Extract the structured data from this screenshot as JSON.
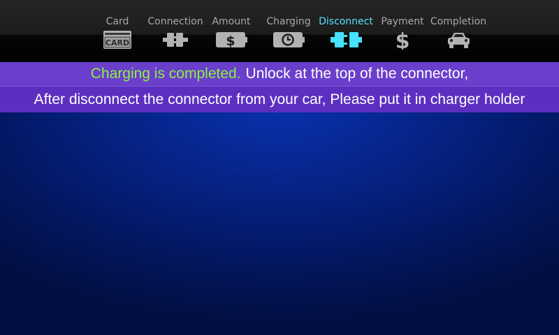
{
  "steps": [
    {
      "label": "Card",
      "icon": "card-icon",
      "icon_text": "CARD"
    },
    {
      "label": "Connection",
      "icon": "connector-icon"
    },
    {
      "label": "Amount",
      "icon": "dollar-battery-icon"
    },
    {
      "label": "Charging",
      "icon": "clock-battery-icon"
    },
    {
      "label": "Disconnect",
      "icon": "disconnect-plug-icon"
    },
    {
      "label": "Payment",
      "icon": "dollar-icon"
    },
    {
      "label": "Completion",
      "icon": "car-icon"
    }
  ],
  "active_step": "Disconnect",
  "colors": {
    "active_step": "#55e3ff",
    "inactive_step": "#a9a9a9",
    "highlight_text": "#8df045",
    "banner": "#6a3fcb"
  },
  "message": {
    "highlight": "Charging is completed.",
    "line1_rest": "Unlock at the top of the connector,",
    "line2": "After disconnect the connector from your car, Please put it in charger holder"
  }
}
